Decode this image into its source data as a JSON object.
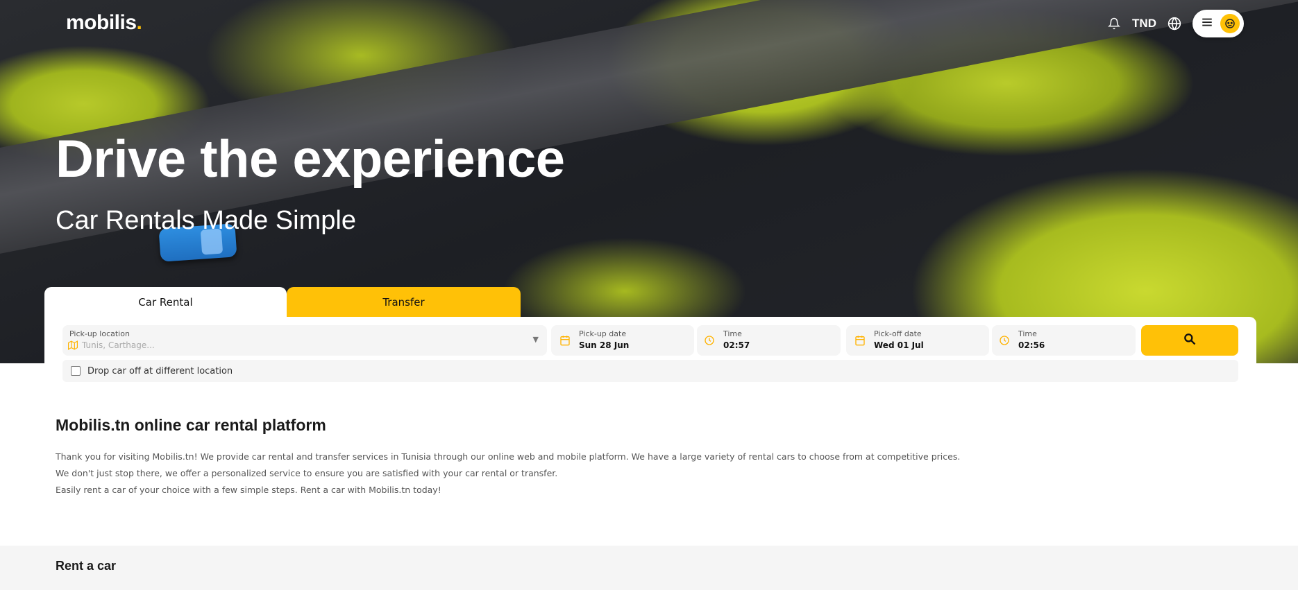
{
  "brand": {
    "logo_text": "mobilis",
    "logo_dot": ".",
    "accent_color": "#ffc107"
  },
  "header": {
    "notification_icon": "bell-icon",
    "currency": "TND",
    "language_icon": "globe-icon",
    "menu_icon": "hamburger-icon",
    "avatar_icon": "user-avatar-icon"
  },
  "hero": {
    "title": "Drive the experience",
    "subtitle": "Car Rentals Made Simple"
  },
  "tabs": [
    {
      "label": "Car Rental",
      "active": true
    },
    {
      "label": "Transfer",
      "active": false
    }
  ],
  "search": {
    "pickup_location": {
      "label": "Pick-up location",
      "placeholder": "Tunis, Carthage..."
    },
    "pickup_date": {
      "label": "Pick-up date",
      "value": "Sun 28 Jun"
    },
    "pickup_time": {
      "label": "Time",
      "value": "02:57"
    },
    "dropoff_date": {
      "label": "Pick-off date",
      "value": "Wed 01 Jul"
    },
    "dropoff_time": {
      "label": "Time",
      "value": "02:56"
    },
    "dropoff_different_label": "Drop car off at different location"
  },
  "intro": {
    "title": "Mobilis.tn online car rental platform",
    "paragraphs": [
      "Thank you for visiting Mobilis.tn! We provide car rental and transfer services in Tunisia through our online web and mobile platform. We have a large variety of rental cars to choose from at competitive prices.",
      "We don't just stop there, we offer a personalized service to ensure you are satisfied with your car rental or transfer.",
      "Easily rent a car of your choice with a few simple steps. Rent a car with Mobilis.tn today!"
    ]
  },
  "rent": {
    "title": "Rent a car"
  }
}
